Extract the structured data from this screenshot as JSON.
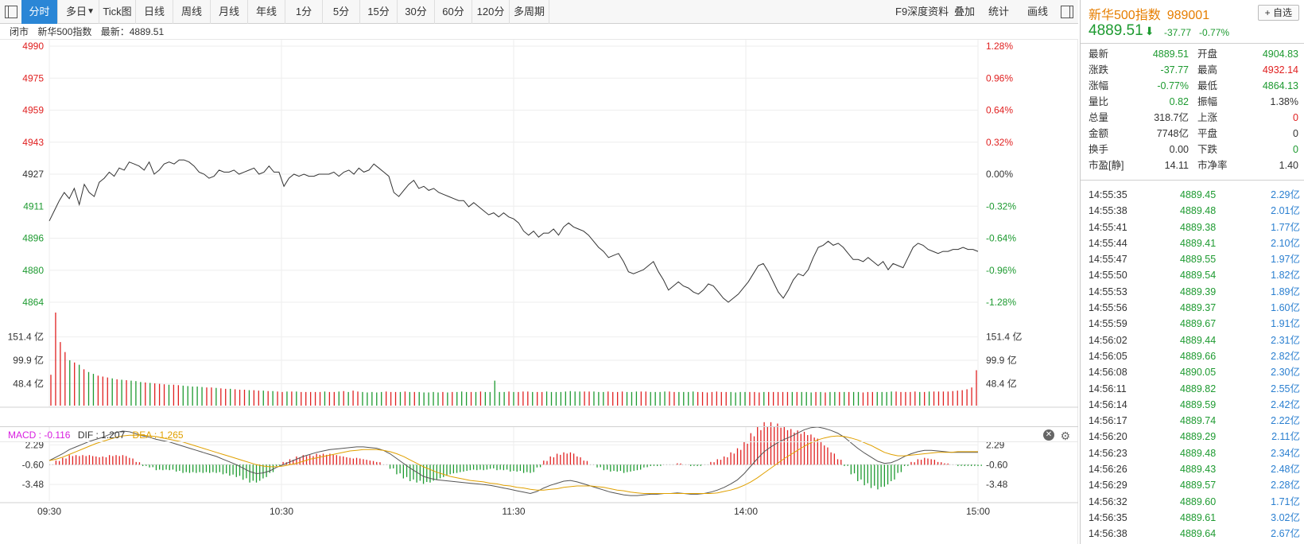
{
  "toolbar": {
    "tabs": [
      "分时",
      "多日",
      "Tick图",
      "日线",
      "周线",
      "月线",
      "年线",
      "1分",
      "5分",
      "15分",
      "30分",
      "60分",
      "120分",
      "多周期"
    ],
    "right_items": [
      "F9深度资料",
      "叠加",
      "统计",
      "画线"
    ],
    "dropdown_arrow": "▼"
  },
  "status": {
    "state": "闭市",
    "name": "新华500指数",
    "latest_label": "最新：",
    "latest": "4889.51"
  },
  "macd": {
    "label": "MACD : -0.116",
    "dif": "DIF : 1.207",
    "dea": "DEA : 1.265",
    "colors": {
      "macd": "#d81ee0",
      "dif": "#555555",
      "dea": "#e0a000"
    }
  },
  "colors": {
    "up": "#e02020",
    "down": "#1d9a30",
    "price_line": "#333333",
    "grid": "#eeeeee",
    "active_tab": "#2a86d6",
    "tick_volume": "#2a7fd0"
  },
  "chart_data": [
    {
      "type": "line",
      "name": "price",
      "x_ticks": [
        "09:30",
        "10:30",
        "11:30",
        "14:00",
        "15:00"
      ],
      "y_left_ticks": [
        "4990",
        "4975",
        "4959",
        "4943",
        "4927",
        "4911",
        "4896",
        "4880",
        "4864"
      ],
      "y_right_ticks": [
        "1.28%",
        "0.96%",
        "0.64%",
        "0.32%",
        "0.00%",
        "-0.32%",
        "-0.64%",
        "-0.96%",
        "-1.28%"
      ],
      "ylim": [
        4864,
        4990
      ],
      "reference": 4927.28,
      "values": [
        4904,
        4909,
        4914,
        4918,
        4915,
        4920,
        4912,
        4922,
        4918,
        4916,
        4923,
        4925,
        4928,
        4926,
        4930,
        4929,
        4933,
        4932,
        4931,
        4929,
        4933,
        4927,
        4929,
        4932,
        4933,
        4932,
        4934,
        4934,
        4933,
        4931,
        4928,
        4927,
        4925,
        4926,
        4929,
        4928,
        4928,
        4929,
        4927,
        4928,
        4929,
        4930,
        4927,
        4928,
        4931,
        4928,
        4928,
        4921,
        4925,
        4927,
        4926,
        4927,
        4926,
        4926,
        4927,
        4927,
        4927,
        4928,
        4926,
        4928,
        4929,
        4927,
        4930,
        4928,
        4929,
        4932,
        4930,
        4928,
        4926,
        4918,
        4916,
        4919,
        4922,
        4924,
        4920,
        4921,
        4919,
        4920,
        4918,
        4917,
        4916,
        4915,
        4914,
        4914,
        4911,
        4913,
        4911,
        4909,
        4907,
        4908,
        4906,
        4908,
        4906,
        4905,
        4903,
        4899,
        4897,
        4899,
        4896,
        4898,
        4898,
        4900,
        4897,
        4901,
        4903,
        4901,
        4900,
        4899,
        4897,
        4894,
        4891,
        4889,
        4886,
        4887,
        4888,
        4884,
        4879,
        4878,
        4879,
        4880,
        4882,
        4884,
        4879,
        4875,
        4870,
        4872,
        4874,
        4872,
        4871,
        4869,
        4868,
        4870,
        4873,
        4872,
        4869,
        4866,
        4864,
        4866,
        4868,
        4871,
        4874,
        4878,
        4882,
        4883,
        4879,
        4874,
        4869,
        4866,
        4870,
        4875,
        4878,
        4877,
        4880,
        4886,
        4891,
        4892,
        4894,
        4892,
        4893,
        4891,
        4888,
        4885,
        4885,
        4884,
        4886,
        4884,
        4882,
        4884,
        4880,
        4883,
        4882,
        4881,
        4886,
        4891,
        4893,
        4892,
        4890,
        4889,
        4888,
        4889,
        4889,
        4890,
        4890,
        4891,
        4890,
        4890,
        4889
      ],
      "close": 4889.51
    },
    {
      "type": "bar",
      "name": "volume",
      "unit": "亿",
      "y_ticks": [
        "151.4 亿",
        "99.9 亿",
        "48.4 亿"
      ],
      "ylim": [
        0,
        205
      ],
      "values": [
        68,
        205,
        140,
        118,
        100,
        95,
        90,
        80,
        74,
        70,
        66,
        64,
        62,
        60,
        58,
        57,
        56,
        55,
        54,
        52,
        51,
        50,
        49,
        48,
        47,
        46,
        46,
        45,
        44,
        43,
        42,
        42,
        41,
        40,
        40,
        39,
        38,
        37,
        37,
        36,
        35,
        35,
        34,
        34,
        33,
        33,
        32,
        32,
        31,
        30,
        31,
        31,
        31,
        30,
        30,
        30,
        30,
        30,
        31,
        30,
        30,
        31,
        32,
        30,
        33,
        31,
        30,
        29,
        30,
        29,
        30,
        31,
        30,
        30,
        30,
        31,
        30,
        30,
        30,
        29,
        29,
        30,
        29,
        30,
        29,
        30,
        30,
        31,
        30,
        30,
        30,
        31,
        30,
        30,
        55,
        30,
        30,
        31,
        30,
        30,
        31,
        31,
        30,
        30,
        30,
        31,
        30,
        30,
        30,
        31,
        32,
        31,
        31,
        31,
        31,
        31,
        30,
        30,
        31,
        30,
        30,
        31,
        30,
        30,
        31,
        31,
        31,
        30,
        30,
        30,
        31,
        31,
        30,
        30,
        30,
        30,
        31,
        30,
        30,
        29,
        30,
        31,
        30,
        30,
        30,
        29,
        30,
        30,
        30,
        30,
        29,
        30,
        30,
        30,
        30,
        30,
        30,
        30,
        30,
        30,
        30,
        29,
        30,
        30,
        29,
        30,
        30,
        30,
        30,
        30,
        30,
        30,
        29,
        30,
        30,
        30,
        30,
        30,
        31,
        31,
        30,
        30,
        30,
        31,
        30,
        30,
        31,
        31,
        31,
        31,
        31,
        32,
        33,
        34,
        36,
        40,
        78
      ]
    },
    {
      "type": "line",
      "name": "MACD",
      "y_ticks": [
        "2.29",
        "-0.60",
        "-3.48"
      ],
      "ylim": [
        -5.9,
        5.0
      ],
      "dif": [
        0,
        0.5,
        1.0,
        1.6,
        2.0,
        2.4,
        2.8,
        3.1,
        3.4,
        3.8,
        4.1,
        4.3,
        4.2,
        3.9,
        3.6,
        3.4,
        3.1,
        2.9,
        2.7,
        2.4,
        2.1,
        1.8,
        1.5,
        1.2,
        0.9,
        0.6,
        0.2,
        -0.2,
        -0.6,
        -1.1,
        -1.6,
        -1.9,
        -1.8,
        -1.5,
        -1.0,
        -0.6,
        -0.2,
        0.2,
        0.6,
        0.9,
        1.2,
        1.4,
        1.6,
        1.7,
        1.8,
        1.9,
        2.0,
        2.0,
        1.9,
        1.8,
        1.5,
        1.0,
        0.3,
        -0.4,
        -1.1,
        -1.7,
        -2.3,
        -2.6,
        -2.8,
        -2.9,
        -3.0,
        -3.1,
        -3.2,
        -3.3,
        -3.4,
        -3.5,
        -3.6,
        -3.8,
        -4.0,
        -4.2,
        -4.4,
        -4.6,
        -4.8,
        -4.5,
        -4.0,
        -3.6,
        -3.3,
        -3.0,
        -2.9,
        -3.1,
        -3.4,
        -3.7,
        -4.0,
        -4.3,
        -4.6,
        -4.8,
        -5.0,
        -5.1,
        -5.1,
        -5.0,
        -4.9,
        -4.9,
        -4.8,
        -4.8,
        -4.7,
        -4.8,
        -4.9,
        -4.9,
        -4.8,
        -4.6,
        -4.3,
        -3.9,
        -3.4,
        -2.8,
        -1.9,
        -0.8,
        0.3,
        1.3,
        2.0,
        2.6,
        3.1,
        3.5,
        4.0,
        4.5,
        4.8,
        4.9,
        4.7,
        4.4,
        4.0,
        3.4,
        2.6,
        1.8,
        1.1,
        0.5,
        -0.1,
        -0.4,
        -0.3,
        0.1,
        0.6,
        1.0,
        1.3,
        1.5,
        1.5,
        1.4,
        1.3,
        1.2,
        1.2,
        1.2,
        1.2,
        1.2
      ],
      "dea": [
        0,
        0.2,
        0.5,
        0.9,
        1.3,
        1.7,
        2.1,
        2.5,
        2.8,
        3.1,
        3.4,
        3.6,
        3.7,
        3.7,
        3.7,
        3.6,
        3.5,
        3.3,
        3.1,
        2.9,
        2.7,
        2.4,
        2.1,
        1.8,
        1.5,
        1.2,
        0.9,
        0.6,
        0.3,
        0.0,
        -0.3,
        -0.6,
        -0.8,
        -0.9,
        -0.9,
        -0.8,
        -0.6,
        -0.4,
        -0.1,
        0.2,
        0.4,
        0.6,
        0.8,
        1.0,
        1.2,
        1.4,
        1.5,
        1.6,
        1.6,
        1.6,
        1.5,
        1.3,
        1.0,
        0.6,
        0.1,
        -0.4,
        -0.9,
        -1.3,
        -1.7,
        -2.0,
        -2.3,
        -2.5,
        -2.7,
        -2.9,
        -3.0,
        -3.1,
        -3.3,
        -3.4,
        -3.6,
        -3.7,
        -3.9,
        -4.0,
        -4.2,
        -4.3,
        -4.3,
        -4.2,
        -4.1,
        -3.9,
        -3.8,
        -3.7,
        -3.7,
        -3.7,
        -3.8,
        -3.9,
        -4.1,
        -4.3,
        -4.4,
        -4.6,
        -4.7,
        -4.8,
        -4.8,
        -4.8,
        -4.8,
        -4.8,
        -4.8,
        -4.8,
        -4.8,
        -4.8,
        -4.8,
        -4.8,
        -4.7,
        -4.5,
        -4.3,
        -4.0,
        -3.6,
        -3.1,
        -2.5,
        -1.8,
        -1.1,
        -0.4,
        0.3,
        0.9,
        1.5,
        2.1,
        2.6,
        3.0,
        3.3,
        3.5,
        3.6,
        3.5,
        3.3,
        3.0,
        2.6,
        2.2,
        1.7,
        1.2,
        0.9,
        0.7,
        0.7,
        0.8,
        0.9,
        1.0,
        1.1,
        1.2,
        1.2,
        1.2,
        1.3,
        1.3,
        1.3,
        1.3
      ]
    }
  ],
  "quote": {
    "name": "新华500指数",
    "code": "989001",
    "self_select": "自选",
    "price": "4889.51",
    "arrow": "⬇",
    "change": "-37.77",
    "pct": "-0.77%",
    "stats": [
      {
        "l1": "最新",
        "v1": "4889.51",
        "c1": "dn",
        "l2": "开盘",
        "v2": "4904.83",
        "c2": "dn"
      },
      {
        "l1": "涨跌",
        "v1": "-37.77",
        "c1": "dn",
        "l2": "最高",
        "v2": "4932.14",
        "c2": "up"
      },
      {
        "l1": "涨幅",
        "v1": "-0.77%",
        "c1": "dn",
        "l2": "最低",
        "v2": "4864.13",
        "c2": "dn"
      },
      {
        "l1": "量比",
        "v1": "0.82",
        "c1": "dn",
        "l2": "振幅",
        "v2": "1.38%",
        "c2": "nu"
      },
      {
        "l1": "总量",
        "v1": "318.7亿",
        "c1": "nu",
        "l2": "上涨",
        "v2": "0",
        "c2": "up"
      },
      {
        "l1": "金额",
        "v1": "7748亿",
        "c1": "nu",
        "l2": "平盘",
        "v2": "0",
        "c2": "nu"
      },
      {
        "l1": "换手",
        "v1": "0.00",
        "c1": "nu",
        "l2": "下跌",
        "v2": "0",
        "c2": "dn"
      },
      {
        "l1": "市盈[静]",
        "v1": "14.11",
        "c1": "nu",
        "l2": "市净率",
        "v2": "1.40",
        "c2": "nu"
      }
    ],
    "ticks": [
      {
        "time": "14:55:35",
        "price": "4889.45",
        "vol": "2.29亿"
      },
      {
        "time": "14:55:38",
        "price": "4889.48",
        "vol": "2.01亿"
      },
      {
        "time": "14:55:41",
        "price": "4889.38",
        "vol": "1.77亿"
      },
      {
        "time": "14:55:44",
        "price": "4889.41",
        "vol": "2.10亿"
      },
      {
        "time": "14:55:47",
        "price": "4889.55",
        "vol": "1.97亿"
      },
      {
        "time": "14:55:50",
        "price": "4889.54",
        "vol": "1.82亿"
      },
      {
        "time": "14:55:53",
        "price": "4889.39",
        "vol": "1.89亿"
      },
      {
        "time": "14:55:56",
        "price": "4889.37",
        "vol": "1.60亿"
      },
      {
        "time": "14:55:59",
        "price": "4889.67",
        "vol": "1.91亿"
      },
      {
        "time": "14:56:02",
        "price": "4889.44",
        "vol": "2.31亿"
      },
      {
        "time": "14:56:05",
        "price": "4889.66",
        "vol": "2.82亿"
      },
      {
        "time": "14:56:08",
        "price": "4890.05",
        "vol": "2.30亿"
      },
      {
        "time": "14:56:11",
        "price": "4889.82",
        "vol": "2.55亿"
      },
      {
        "time": "14:56:14",
        "price": "4889.59",
        "vol": "2.42亿"
      },
      {
        "time": "14:56:17",
        "price": "4889.74",
        "vol": "2.22亿"
      },
      {
        "time": "14:56:20",
        "price": "4889.29",
        "vol": "2.11亿"
      },
      {
        "time": "14:56:23",
        "price": "4889.48",
        "vol": "2.34亿"
      },
      {
        "time": "14:56:26",
        "price": "4889.43",
        "vol": "2.48亿"
      },
      {
        "time": "14:56:29",
        "price": "4889.57",
        "vol": "2.28亿"
      },
      {
        "time": "14:56:32",
        "price": "4889.60",
        "vol": "1.71亿"
      },
      {
        "time": "14:56:35",
        "price": "4889.61",
        "vol": "3.02亿"
      },
      {
        "time": "14:56:38",
        "price": "4889.64",
        "vol": "2.67亿"
      }
    ]
  }
}
